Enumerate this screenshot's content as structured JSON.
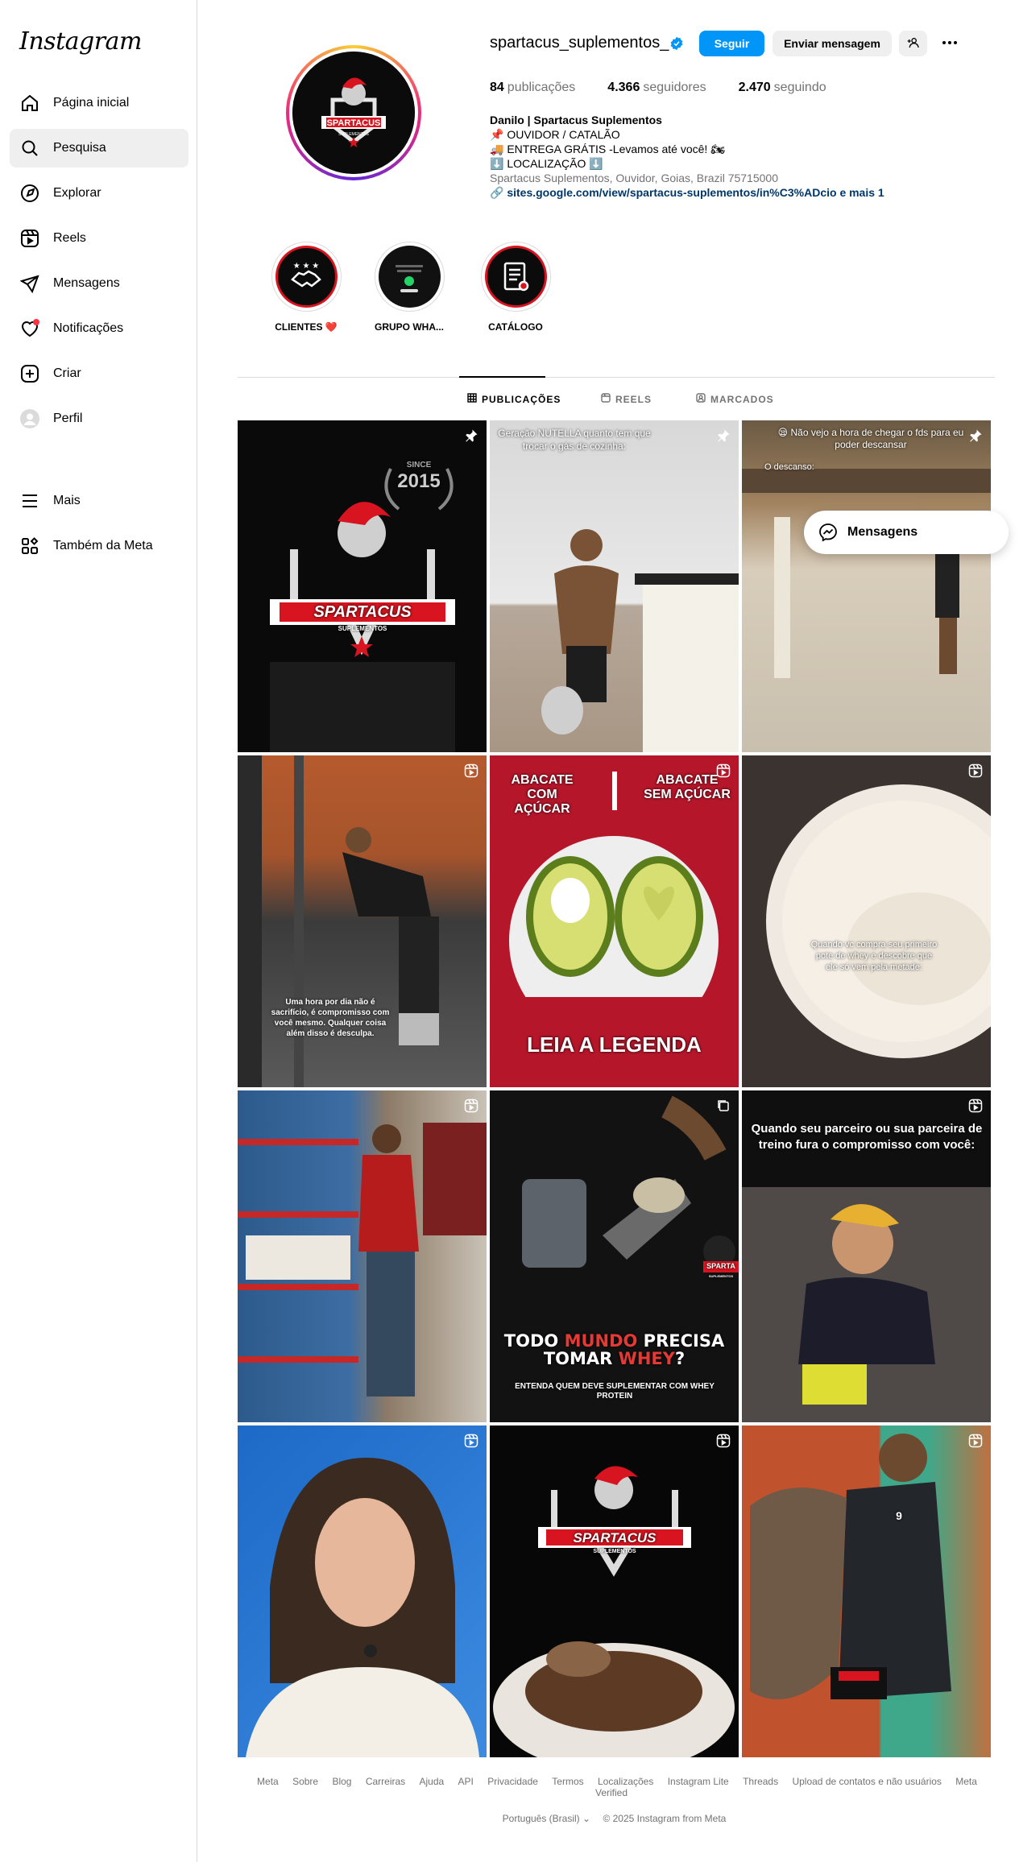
{
  "app": {
    "logo": "Instagram"
  },
  "sidebar": {
    "items": [
      {
        "label": "Página inicial",
        "icon": "home-icon"
      },
      {
        "label": "Pesquisa",
        "icon": "search-icon",
        "active": true
      },
      {
        "label": "Explorar",
        "icon": "compass-icon"
      },
      {
        "label": "Reels",
        "icon": "reels-icon"
      },
      {
        "label": "Mensagens",
        "icon": "send-icon"
      },
      {
        "label": "Notificações",
        "icon": "heart-icon"
      },
      {
        "label": "Criar",
        "icon": "plus-square-icon"
      },
      {
        "label": "Perfil",
        "icon": "profile-avatar-icon"
      }
    ],
    "bottom": [
      {
        "label": "Mais",
        "icon": "menu-icon"
      },
      {
        "label": "Também da Meta",
        "icon": "meta-apps-icon"
      }
    ]
  },
  "profile": {
    "username": "spartacus_suplementos_",
    "follow_label": "Seguir",
    "message_label": "Enviar mensagem",
    "stats": {
      "posts_value": "84",
      "posts_label": "publicações",
      "followers_value": "4.366",
      "followers_label": "seguidores",
      "following_value": "2.470",
      "following_label": "seguindo"
    },
    "bio": {
      "name": "Danilo | Spartacus Suplementos",
      "line1": "📌 OUVIDOR / CATALÃO",
      "line2": "🚚 ENTREGA GRÁTIS -Levamos até você! 🏍",
      "line3": "⬇️ LOCALIZAÇÃO ⬇️",
      "address": "Spartacus Suplementos, Ouvidor, Goias, Brazil 75715000",
      "link": "sites.google.com/view/spartacus-suplementos/in%C3%ADcio e mais 1"
    },
    "avatar_text": {
      "brand": "SPARTACUS",
      "sub": "SUPLEMENTOS"
    }
  },
  "highlights": [
    {
      "label": "CLIENTES ❤️"
    },
    {
      "label": "GRUPO WHA..."
    },
    {
      "label": "CATÁLOGO"
    }
  ],
  "tabs": [
    {
      "label": "PUBLICAÇÕES",
      "icon": "grid-icon"
    },
    {
      "label": "REELS",
      "icon": "reels-icon"
    },
    {
      "label": "MARCADOS",
      "icon": "tagged-icon"
    }
  ],
  "posts": {
    "p1": {
      "since": "SINCE",
      "year": "2015",
      "brand": "SPARTACUS",
      "sub": "SUPLEMENTOS"
    },
    "p2": {
      "caption": "Geração NUTELLA quanto tem que trocar o gás de cozinha:"
    },
    "p3": {
      "caption": "😪 Não vejo a hora de chegar o fds para eu poder descansar",
      "sub": "O descanso:"
    },
    "p4": {
      "caption": "Uma hora por dia não é sacrifício, é compromisso com você mesmo. Qualquer coisa além disso é desculpa."
    },
    "p5": {
      "left": "ABACATE COM AÇÚCAR",
      "right": "ABACATE SEM AÇÚCAR",
      "bottom": "LEIA A LEGENDA"
    },
    "p6": {
      "caption": "Quando vc compra seu primeiro pote de whey e descobre que ele só vem pela metade:"
    },
    "p8": {
      "line1a": "TODO ",
      "line1b": "MUNDO",
      "line1c": " PRECISA",
      "line2a": "TOMAR ",
      "line2b": "WHEY",
      "line2c": "?",
      "line3": "ENTENDA QUEM DEVE SUPLEMENTAR COM WHEY PROTEIN",
      "brand": "SPARTA",
      "sub": "SUPLEMENTOS"
    },
    "p9": {
      "caption": "Quando seu parceiro ou sua parceira de treino fura o compromisso com você:"
    },
    "p11": {
      "brand": "SPARTACUS",
      "sub": "SUPLEMENTOS"
    },
    "p12": {
      "shirt": "9"
    }
  },
  "floating": {
    "messages_label": "Mensagens"
  },
  "footer": {
    "links": [
      "Meta",
      "Sobre",
      "Blog",
      "Carreiras",
      "Ajuda",
      "API",
      "Privacidade",
      "Termos",
      "Localizações",
      "Instagram Lite",
      "Threads",
      "Upload de contatos e não usuários",
      "Meta Verified"
    ],
    "language": "Português (Brasil)",
    "copyright": "© 2025 Instagram from Meta"
  },
  "colors": {
    "accent": "#0095f6",
    "brand_red": "#d7141f",
    "notification_dot": "#ff3040"
  }
}
